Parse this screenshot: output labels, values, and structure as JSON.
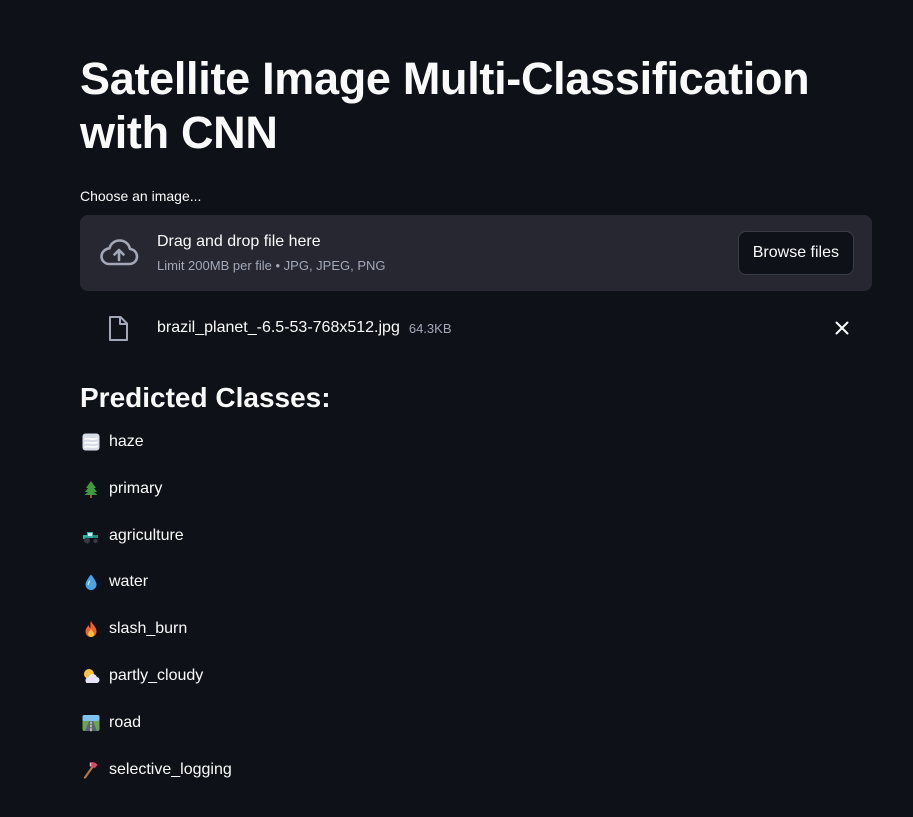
{
  "page": {
    "title": "Satellite Image Multi-Classification\nwith CNN"
  },
  "uploader": {
    "label": "Choose an image...",
    "drop_text": "Drag and drop file here",
    "limit_text": "Limit 200MB per file • JPG, JPEG, PNG",
    "browse_label": "Browse files",
    "cloud_icon": "cloud-upload-icon"
  },
  "file": {
    "name": "brazil_planet_-6.5-53-768x512.jpg",
    "size": "64.3KB",
    "icon": "file-icon",
    "remove_icon": "close-icon"
  },
  "results": {
    "heading": "Predicted Classes:",
    "classes": [
      {
        "label": "haze",
        "icon": "fog-emoji-icon"
      },
      {
        "label": "primary",
        "icon": "evergreen-tree-emoji-icon"
      },
      {
        "label": "agriculture",
        "icon": "tractor-emoji-icon"
      },
      {
        "label": "water",
        "icon": "droplet-emoji-icon"
      },
      {
        "label": "slash_burn",
        "icon": "fire-emoji-icon"
      },
      {
        "label": "partly_cloudy",
        "icon": "sun-behind-cloud-emoji-icon"
      },
      {
        "label": "road",
        "icon": "motorway-emoji-icon"
      },
      {
        "label": "selective_logging",
        "icon": "axe-emoji-icon"
      }
    ]
  },
  "colors": {
    "background": "#0e1117",
    "dropzone": "#262730",
    "text": "#fafafa",
    "muted": "#a3a8b8"
  }
}
